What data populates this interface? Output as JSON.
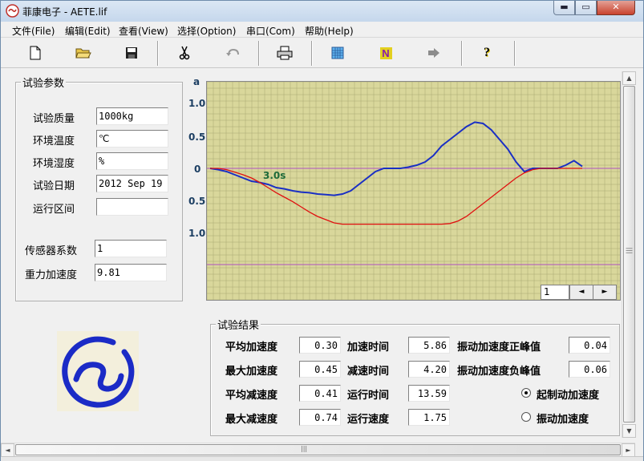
{
  "window": {
    "title": "菲康电子 - AETE.lif",
    "min_glyph": "▬",
    "max_glyph": "▭",
    "close_glyph": "✕"
  },
  "menu": [
    "文件(File)",
    "编辑(Edit)",
    "查看(View)",
    "选择(Option)",
    "串口(Com)",
    "帮助(Help)"
  ],
  "toolbar": {
    "icons": [
      "new-file-icon",
      "open-folder-icon",
      "save-icon",
      "cut-icon",
      "undo-icon",
      "print-icon",
      "grid-icon",
      "n-icon",
      "arrow-right-icon",
      "help-icon"
    ],
    "help_glyph": "?",
    "n_glyph": "N"
  },
  "params": {
    "group_title": "试验参数",
    "fields": [
      {
        "label": "试验质量",
        "value": "1000kg"
      },
      {
        "label": "环境温度",
        "value": "℃"
      },
      {
        "label": "环境湿度",
        "value": "%"
      },
      {
        "label": "试验日期",
        "value": "2012 Sep 19"
      },
      {
        "label": "运行区间",
        "value": ""
      }
    ],
    "sensor_label": "传感器系数",
    "sensor_value": "1",
    "gravity_label": "重力加速度",
    "gravity_value": "9.81"
  },
  "chart_data": {
    "type": "line",
    "ylabel": "a",
    "yticks": [
      "1.0",
      "0.5",
      "0",
      "0.5",
      "1.0"
    ],
    "annotation": "3.0s",
    "series": [
      {
        "color": "#1a2fc4",
        "values": [
          0.0,
          -0.02,
          -0.05,
          -0.1,
          -0.15,
          -0.2,
          -0.22,
          -0.25,
          -0.3,
          -0.32,
          -0.35,
          -0.37,
          -0.38,
          -0.4,
          -0.41,
          -0.42,
          -0.4,
          -0.35,
          -0.25,
          -0.15,
          -0.05,
          0.0,
          0.0,
          0.0,
          0.02,
          0.05,
          0.1,
          0.2,
          0.35,
          0.45,
          0.55,
          0.65,
          0.72,
          0.7,
          0.6,
          0.45,
          0.3,
          0.1,
          -0.05,
          0.0,
          0.0,
          0.0,
          0.0,
          0.05,
          0.12,
          0.03
        ]
      },
      {
        "color": "#e01010",
        "values": [
          0.0,
          0.0,
          -0.02,
          -0.06,
          -0.1,
          -0.15,
          -0.22,
          -0.3,
          -0.38,
          -0.45,
          -0.52,
          -0.6,
          -0.68,
          -0.75,
          -0.8,
          -0.85,
          -0.87,
          -0.87,
          -0.87,
          -0.87,
          -0.87,
          -0.87,
          -0.87,
          -0.87,
          -0.87,
          -0.87,
          -0.87,
          -0.87,
          -0.87,
          -0.86,
          -0.82,
          -0.75,
          -0.65,
          -0.55,
          -0.45,
          -0.35,
          -0.25,
          -0.15,
          -0.07,
          -0.02,
          0.0,
          0.0,
          0.0,
          0.0,
          0.0,
          0.0
        ]
      }
    ],
    "grid": true,
    "ylim": [
      -1.5,
      1.5
    ]
  },
  "pager": {
    "value": "1",
    "prev": "◄",
    "next": "►"
  },
  "results": {
    "group_title": "试验结果",
    "rows": [
      {
        "l1": "平均加速度",
        "v1": "0.30",
        "l2": "加速时间",
        "v2": "5.86",
        "l3": "振动加速度正峰值",
        "v3": "0.04"
      },
      {
        "l1": "最大加速度",
        "v1": "0.45",
        "l2": "减速时间",
        "v2": "4.20",
        "l3": "振动加速度负峰值",
        "v3": "0.06"
      },
      {
        "l1": "平均减速度",
        "v1": "0.41",
        "l2": "运行时间",
        "v2": "13.59",
        "l3": "起制动加速度"
      },
      {
        "l1": "最大减速度",
        "v1": "0.74",
        "l2": "运行速度",
        "v2": "1.75",
        "l3": "振动加速度"
      }
    ],
    "radio_selected": "起制动加速度"
  },
  "scroll": {
    "up": "▲",
    "down": "▼",
    "left": "◄",
    "right": "►",
    "grip": "|||"
  }
}
